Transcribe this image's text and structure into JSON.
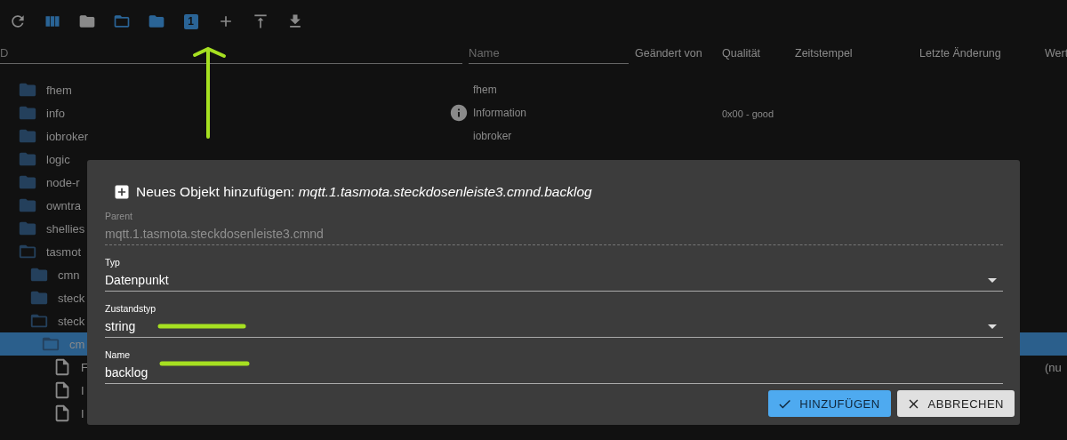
{
  "toolbar": [
    {
      "kind": "refresh",
      "active": false
    },
    {
      "kind": "columns",
      "active": true
    },
    {
      "kind": "folder",
      "active": false
    },
    {
      "kind": "folder-open",
      "active": true
    },
    {
      "kind": "folder",
      "active": true
    },
    {
      "kind": "badge",
      "active": true,
      "label": "1"
    },
    {
      "kind": "add",
      "active": false
    },
    {
      "kind": "upload",
      "active": false
    },
    {
      "kind": "download",
      "active": false
    }
  ],
  "filter": {
    "id_placeholder": "D",
    "name_placeholder": "Name"
  },
  "columns": [
    "Geändert von",
    "Qualität",
    "Zeitstempel",
    "Letzte Änderung",
    "Wert"
  ],
  "tree": [
    {
      "label": "fhem",
      "kind": "folder",
      "expanded": false,
      "selected": false,
      "name": "fhem"
    },
    {
      "label": "info",
      "kind": "folder",
      "expanded": false,
      "selected": false,
      "name": "Information",
      "has_icon": true,
      "quality": "0x00 - good"
    },
    {
      "label": "iobroker",
      "kind": "folder",
      "expanded": false,
      "selected": false,
      "name": "iobroker"
    },
    {
      "label": "logic",
      "kind": "folder",
      "expanded": false,
      "selected": false
    },
    {
      "label": "node-r",
      "kind": "folder",
      "expanded": false,
      "selected": false
    },
    {
      "label": "owntra",
      "kind": "folder",
      "expanded": false,
      "selected": false
    },
    {
      "label": "shellies",
      "kind": "folder",
      "expanded": false,
      "selected": false
    },
    {
      "label": "tasmot",
      "kind": "folder",
      "expanded": true,
      "selected": false,
      "children": [
        {
          "label": "cmn",
          "kind": "folder",
          "expanded": false,
          "selected": false
        },
        {
          "label": "steck",
          "kind": "folder",
          "expanded": false,
          "selected": false
        },
        {
          "label": "steck",
          "kind": "folder",
          "expanded": true,
          "selected": false,
          "children": [
            {
              "label": "cm",
              "kind": "folder",
              "expanded": true,
              "selected": true,
              "children": [
                {
                  "label": "F",
                  "kind": "state",
                  "selected": false,
                  "value": "(nu"
                },
                {
                  "label": "I",
                  "kind": "state",
                  "selected": false
                },
                {
                  "label": "I",
                  "kind": "state",
                  "selected": false
                }
              ]
            }
          ]
        }
      ]
    }
  ],
  "dialog": {
    "title": "Neues Objekt hinzufügen: *mqtt.1.tasmota.steckdosenleiste3.cmnd.backlog*",
    "fields": [
      {
        "label": "Parent",
        "value": "mqtt.1.tasmota.steckdosenleiste3.cmnd",
        "kind": "text",
        "disabled": true
      },
      {
        "label": "Typ",
        "value": "Datenpunkt",
        "kind": "select",
        "disabled": false
      },
      {
        "label": "Zustandstyp",
        "value": "string",
        "kind": "select",
        "disabled": false
      },
      {
        "label": "Name",
        "value": "backlog",
        "kind": "text",
        "disabled": false
      }
    ],
    "buttons": [
      {
        "label": "HINZUFÜGEN",
        "kind": "primary"
      },
      {
        "label": "ABBRECHEN",
        "kind": "secondary"
      }
    ]
  }
}
